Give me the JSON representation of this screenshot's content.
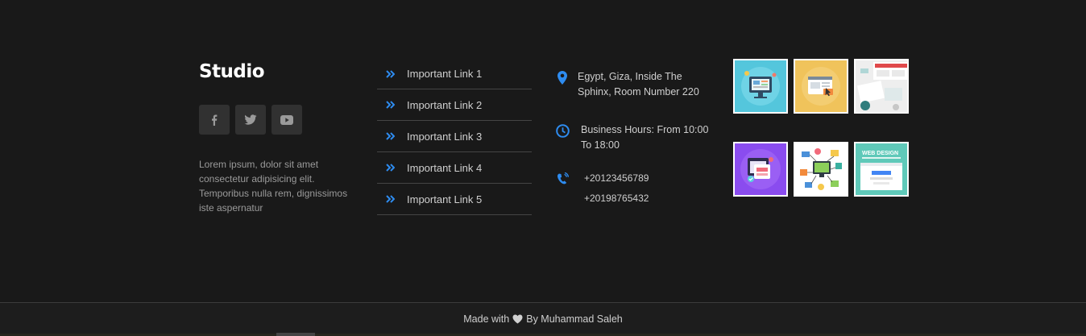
{
  "studio": {
    "title": "Studio",
    "description": "Lorem ipsum, dolor sit amet consectetur adipisicing elit. Temporibus nulla rem, dignissimos iste aspernatur",
    "socials": [
      {
        "icon": "facebook-icon"
      },
      {
        "icon": "twitter-icon"
      },
      {
        "icon": "youtube-icon"
      }
    ]
  },
  "links": [
    {
      "label": "Important Link 1"
    },
    {
      "label": "Important Link 2"
    },
    {
      "label": "Important Link 3"
    },
    {
      "label": "Important Link 4"
    },
    {
      "label": "Important Link 5"
    }
  ],
  "contact": {
    "address": "Egypt, Giza, Inside The Sphinx, Room Number 220",
    "hours": "Business Hours: From 10:00 To 18:00",
    "phones": [
      "+20123456789",
      "+20198765432"
    ]
  },
  "footer": {
    "made_with": "Made with",
    "by": "By Muhammad Saleh"
  },
  "colors": {
    "accent": "#2e8cf0",
    "background": "#191919",
    "social_bg": "#313131"
  }
}
